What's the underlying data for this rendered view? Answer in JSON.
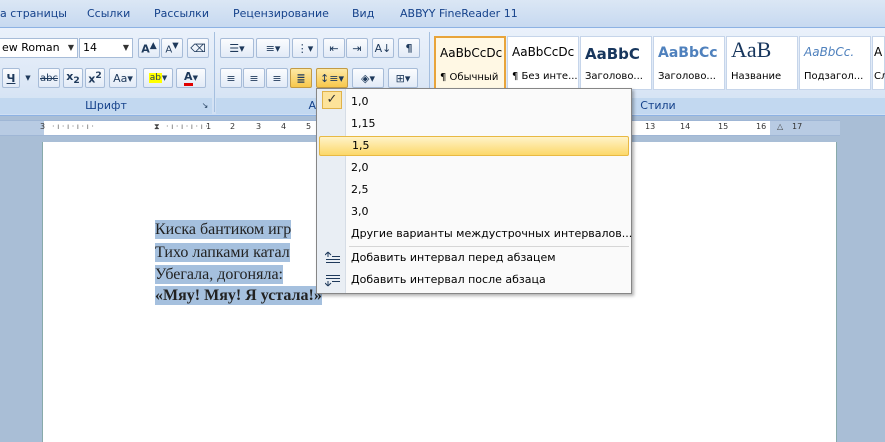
{
  "ribbon_tabs": [
    "а страницы",
    "Ссылки",
    "Рассылки",
    "Рецензирование",
    "Вид",
    "ABBYY FineReader 11"
  ],
  "font": {
    "name": "ew Roman",
    "size": "14"
  },
  "groups": {
    "font_label": "Шрифт",
    "paragraph_label": "Абза",
    "styles_label": "Стили"
  },
  "styles": [
    {
      "sample": "AaBbCcDc",
      "name": "¶ Обычный"
    },
    {
      "sample": "AaBbCcDc",
      "name": "¶ Без инте..."
    },
    {
      "sample": "AaBbC",
      "name": "Заголово..."
    },
    {
      "sample": "AaBbCc",
      "name": "Заголово..."
    },
    {
      "sample": "AaB",
      "name": "Название"
    },
    {
      "sample": "AaBbCc.",
      "name": "Подзагол..."
    },
    {
      "sample": "A",
      "name": "Сл"
    }
  ],
  "ruler_ticks": [
    "3",
    "1",
    "2",
    "3",
    "4",
    "5",
    "6",
    "13",
    "14",
    "15",
    "16",
    "17"
  ],
  "document_lines": [
    "Киска бантиком игр",
    "Тихо лапками катал",
    "Убегала, догоняла:",
    "«Мяу! Мяу! Я устала!»"
  ],
  "line_spacing_menu": {
    "options": [
      "1,0",
      "1,15",
      "1,5",
      "2,0",
      "2,5",
      "3,0"
    ],
    "checked": "1,0",
    "highlighted": "1,5",
    "more_options": "Другие варианты междустрочных интервалов...",
    "add_before": "Добавить интервал перед абзацем",
    "add_after": "Добавить интервал после абзаца"
  },
  "colors": {
    "highlight": "#fcd86a",
    "selection": "#a5c0de",
    "ribbon": "#dde8f6"
  }
}
